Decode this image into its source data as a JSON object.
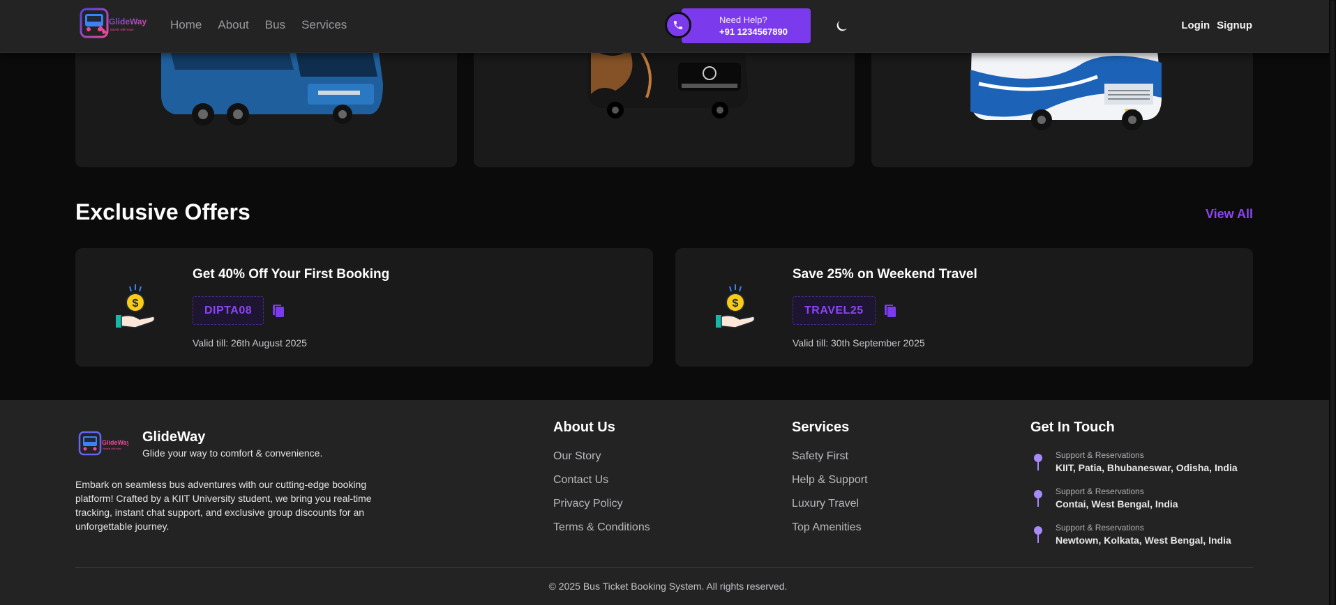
{
  "nav": {
    "logo_text": "GlideWay",
    "logo_sub": "travels with ease",
    "links": [
      "Home",
      "About",
      "Bus",
      "Services"
    ],
    "help_title": "Need Help?",
    "help_number": "+91 1234567890",
    "login": "Login",
    "signup": "Signup"
  },
  "offers": {
    "title": "Exclusive Offers",
    "view_all": "View All",
    "items": [
      {
        "title": "Get 40% Off Your First Booking",
        "code": "DIPTA08",
        "valid": "Valid till: 26th August 2025"
      },
      {
        "title": "Save 25% on Weekend Travel",
        "code": "TRAVEL25",
        "valid": "Valid till: 30th September 2025"
      }
    ]
  },
  "footer": {
    "brand": "GlideWay",
    "tagline": "Glide your way to comfort & convenience.",
    "description": "Embark on seamless bus adventures with our cutting-edge booking platform! Crafted by a KIIT University student, we bring you real-time tracking, instant chat support, and exclusive group discounts for an unforgettable journey.",
    "about": {
      "heading": "About Us",
      "links": [
        "Our Story",
        "Contact Us",
        "Privacy Policy",
        "Terms & Conditions"
      ]
    },
    "services": {
      "heading": "Services",
      "links": [
        "Safety First",
        "Help & Support",
        "Luxury Travel",
        "Top Amenities"
      ]
    },
    "contact": {
      "heading": "Get In Touch",
      "items": [
        {
          "label": "Support & Reservations",
          "address": "KIIT, Patia, Bhubaneswar, Odisha, India"
        },
        {
          "label": "Support & Reservations",
          "address": "Contai, West Bengal, India"
        },
        {
          "label": "Support & Reservations",
          "address": "Newtown, Kolkata, West Bengal, India"
        }
      ]
    },
    "copyright": "© 2025 Bus Ticket Booking System. All rights reserved."
  },
  "colors": {
    "accent": "#7c3aed",
    "background": "#0b0b0c",
    "card": "#1a1a1b",
    "navbar": "#232324"
  },
  "icons": [
    "phone-icon",
    "moon-icon",
    "money-hand-icon",
    "copy-icon",
    "location-pin-icon"
  ]
}
